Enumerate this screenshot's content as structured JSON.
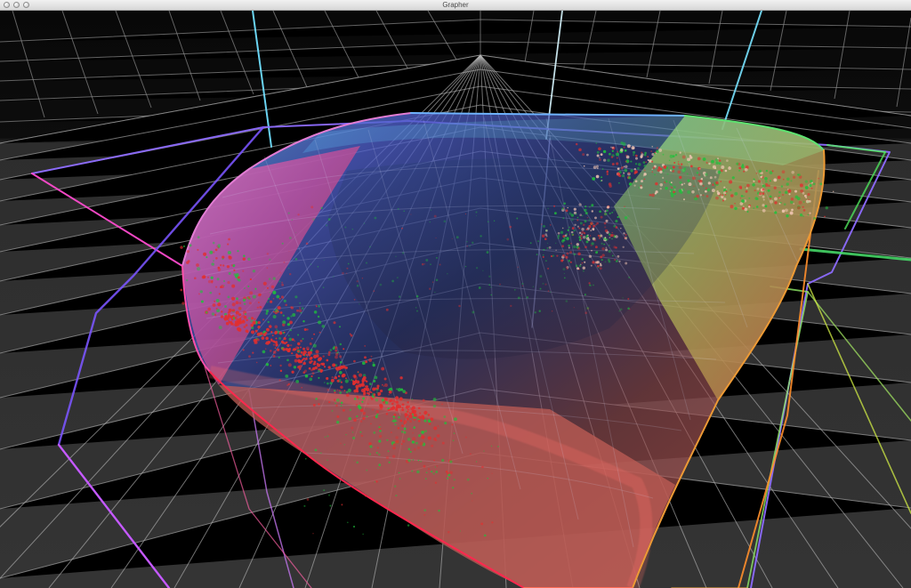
{
  "window": {
    "title": "Grapher"
  },
  "window_controls": {
    "close": "close-button",
    "minimize": "minimize-button",
    "zoom": "zoom-button"
  },
  "scene": {
    "background_top": "#090909",
    "floor_color": "#343434",
    "wall_color": "#101010",
    "grid_color": "#bcbcbc",
    "gamut_colors": {
      "magenta": "#d44cc9",
      "blue": "#4b78ff",
      "cyan": "#63d5ff",
      "green": "#39e04b",
      "yellow": "#d7c443",
      "orange": "#f0802d",
      "red": "#ff315c"
    },
    "point_colors": {
      "red": "#e12f2f",
      "green": "#1fc13b",
      "pale": "#f2c7b4"
    }
  }
}
